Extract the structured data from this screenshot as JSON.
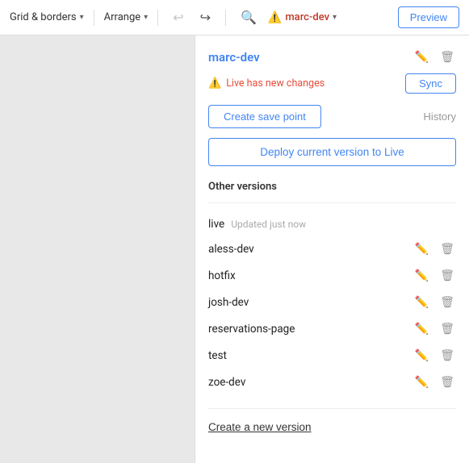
{
  "toolbar": {
    "grid_label": "Grid & borders",
    "arrange_label": "Arrange",
    "preview_label": "Preview",
    "warning_label": "marc-dev",
    "undo_title": "Undo",
    "redo_title": "Redo",
    "search_title": "Search"
  },
  "panel": {
    "current_version_name": "marc-dev",
    "alert_text": "Live has new changes",
    "sync_label": "Sync",
    "save_point_label": "Create save point",
    "history_label": "History",
    "deploy_label": "Deploy current version to Live",
    "other_versions_title": "Other versions",
    "versions": [
      {
        "name": "live",
        "tag": "Updated just now",
        "actions": false
      },
      {
        "name": "aless-dev",
        "tag": "",
        "actions": true
      },
      {
        "name": "hotfix",
        "tag": "",
        "actions": true
      },
      {
        "name": "josh-dev",
        "tag": "",
        "actions": true
      },
      {
        "name": "reservations-page",
        "tag": "",
        "actions": true
      },
      {
        "name": "test",
        "tag": "",
        "actions": true
      },
      {
        "name": "zoe-dev",
        "tag": "",
        "actions": true
      }
    ],
    "create_new_label": "Create a new version"
  }
}
